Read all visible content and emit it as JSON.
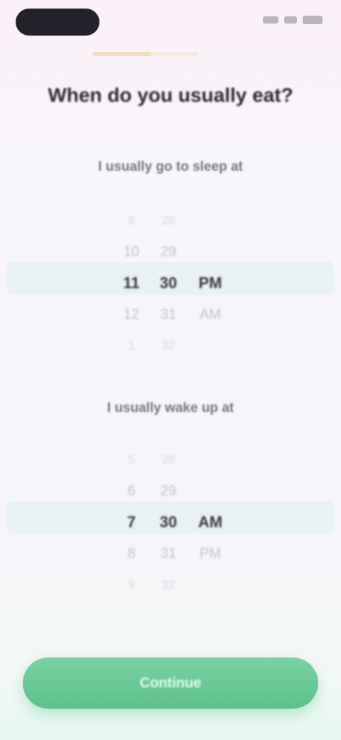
{
  "status_bar": {
    "icons": [
      "signal-icon",
      "wifi-icon",
      "battery-icon"
    ]
  },
  "progress": {
    "value": 0.55
  },
  "header": {
    "title": "When do you usually eat?"
  },
  "sleep_picker": {
    "label": "I usually go to sleep at",
    "hours": [
      "9",
      "10",
      "11",
      "12",
      "1"
    ],
    "minutes": [
      "28",
      "29",
      "30",
      "31",
      "32"
    ],
    "periods": [
      "",
      "",
      "PM",
      "AM",
      ""
    ]
  },
  "wake_picker": {
    "label": "I usually wake up at",
    "hours": [
      "5",
      "6",
      "7",
      "8",
      "9"
    ],
    "minutes": [
      "28",
      "29",
      "30",
      "31",
      "32"
    ],
    "periods": [
      "",
      "",
      "AM",
      "PM",
      ""
    ]
  },
  "footer": {
    "continue_label": "Continue"
  },
  "colors": {
    "accent": "#5fc08c",
    "progress_fill": "#f3dcc0",
    "highlight_band": "#e9f2f2"
  }
}
